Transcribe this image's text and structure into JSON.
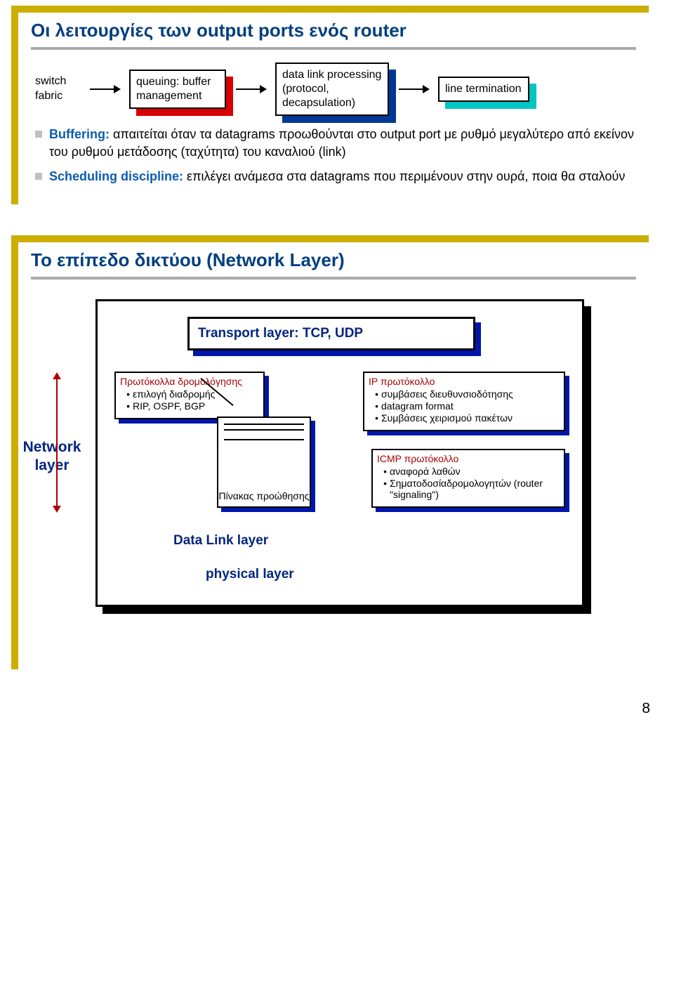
{
  "slide1": {
    "title": "Οι λειτουργίες των output ports ενός router",
    "pipeline": {
      "left_label_a": "switch",
      "left_label_b": "fabric",
      "box1": "queuing: buffer management",
      "box2": "data link processing (protocol, decapsulation)",
      "box3": "line termination"
    },
    "bullet1_lead": "Buffering:",
    "bullet1_rest": "απαιτείται όταν τα datagrams προωθούνται στο output port με ρυθμό μεγαλύτερο από εκείνον του ρυθμού μετάδοσης (ταχύτητα) του καναλιού (link)",
    "bullet2_lead": "Scheduling discipline:",
    "bullet2_rest": "επιλέγει ανάμεσα στα datagrams που περιμένουν στην ουρά, ποια θα σταλούν"
  },
  "slide2": {
    "title": "Το επίπεδο δικτύου (Network Layer)",
    "side_label": "Network layer",
    "transport": "Transport layer: TCP, UDP",
    "datalink": "Data Link layer",
    "physical": "physical layer",
    "routing": {
      "title": "Πρωτόκολλα δρομολόγησης",
      "items": [
        "επιλογή διαδρομής",
        "RIP, OSPF, BGP"
      ]
    },
    "table_caption": "Πίνακας προώθησης",
    "ip": {
      "title": "IP πρωτόκολλο",
      "items": [
        "συμβάσεις διευθυνσιοδότησης",
        "datagram format",
        "Συμβάσεις χειρισμού πακέτων"
      ]
    },
    "icmp": {
      "title": "ICMP πρωτόκολλο",
      "items": [
        "αναφορά λαθών",
        "Σηματοδοσίαδρομολογητών (router \"signaling\")"
      ]
    }
  },
  "page_number": "8"
}
